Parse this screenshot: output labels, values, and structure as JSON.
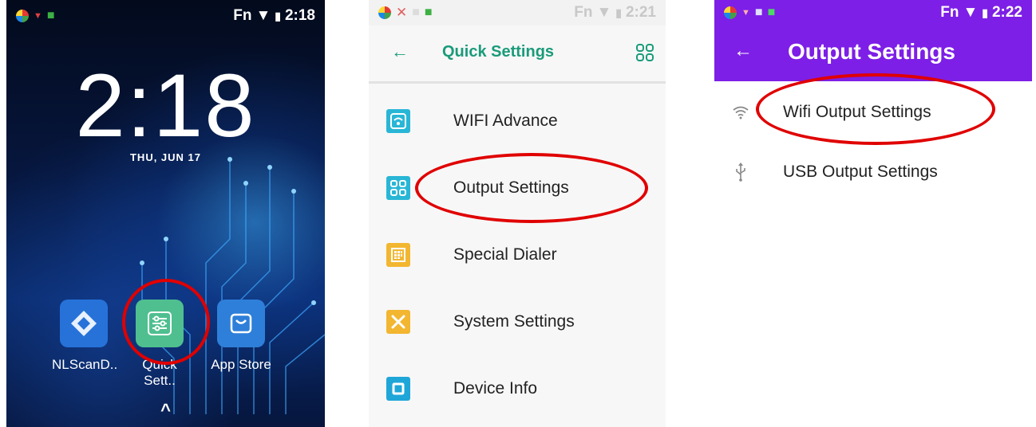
{
  "home": {
    "status_fn": "Fn",
    "status_time": "2:18",
    "clock": "2:18",
    "date": "THU, JUN 17",
    "apps": [
      {
        "label": "NLScanD..",
        "icon": "nlscan-icon"
      },
      {
        "label": "Quick Sett..",
        "icon": "sliders-icon"
      },
      {
        "label": "App Store",
        "icon": "shopping-bag-icon"
      }
    ],
    "nav_glyph": "^"
  },
  "quick_settings": {
    "status_fn": "Fn",
    "status_time": "2:21",
    "title": "Quick Settings",
    "back_glyph": "←",
    "items": [
      {
        "label": "WIFI Advance",
        "icon": "wifi-advance-icon",
        "color": "#29b6d6"
      },
      {
        "label": "Output Settings",
        "icon": "output-grid-icon",
        "color": "#29b6d6"
      },
      {
        "label": "Special Dialer",
        "icon": "dialer-keypad-icon",
        "color": "#f2b630"
      },
      {
        "label": "System Settings",
        "icon": "tools-icon",
        "color": "#f2b630"
      },
      {
        "label": "Device Info",
        "icon": "chip-icon",
        "color": "#1fa6d8"
      }
    ]
  },
  "output_settings": {
    "status_fn": "Fn",
    "status_time": "2:22",
    "title": "Output Settings",
    "back_glyph": "←",
    "items": [
      {
        "label": "Wifi Output Settings",
        "icon": "wifi-icon"
      },
      {
        "label": "USB Output Settings",
        "icon": "usb-icon"
      }
    ]
  },
  "colors": {
    "accent_green": "#1a9b7a",
    "header_purple": "#7d1fe6",
    "highlight_red": "#e00000"
  }
}
